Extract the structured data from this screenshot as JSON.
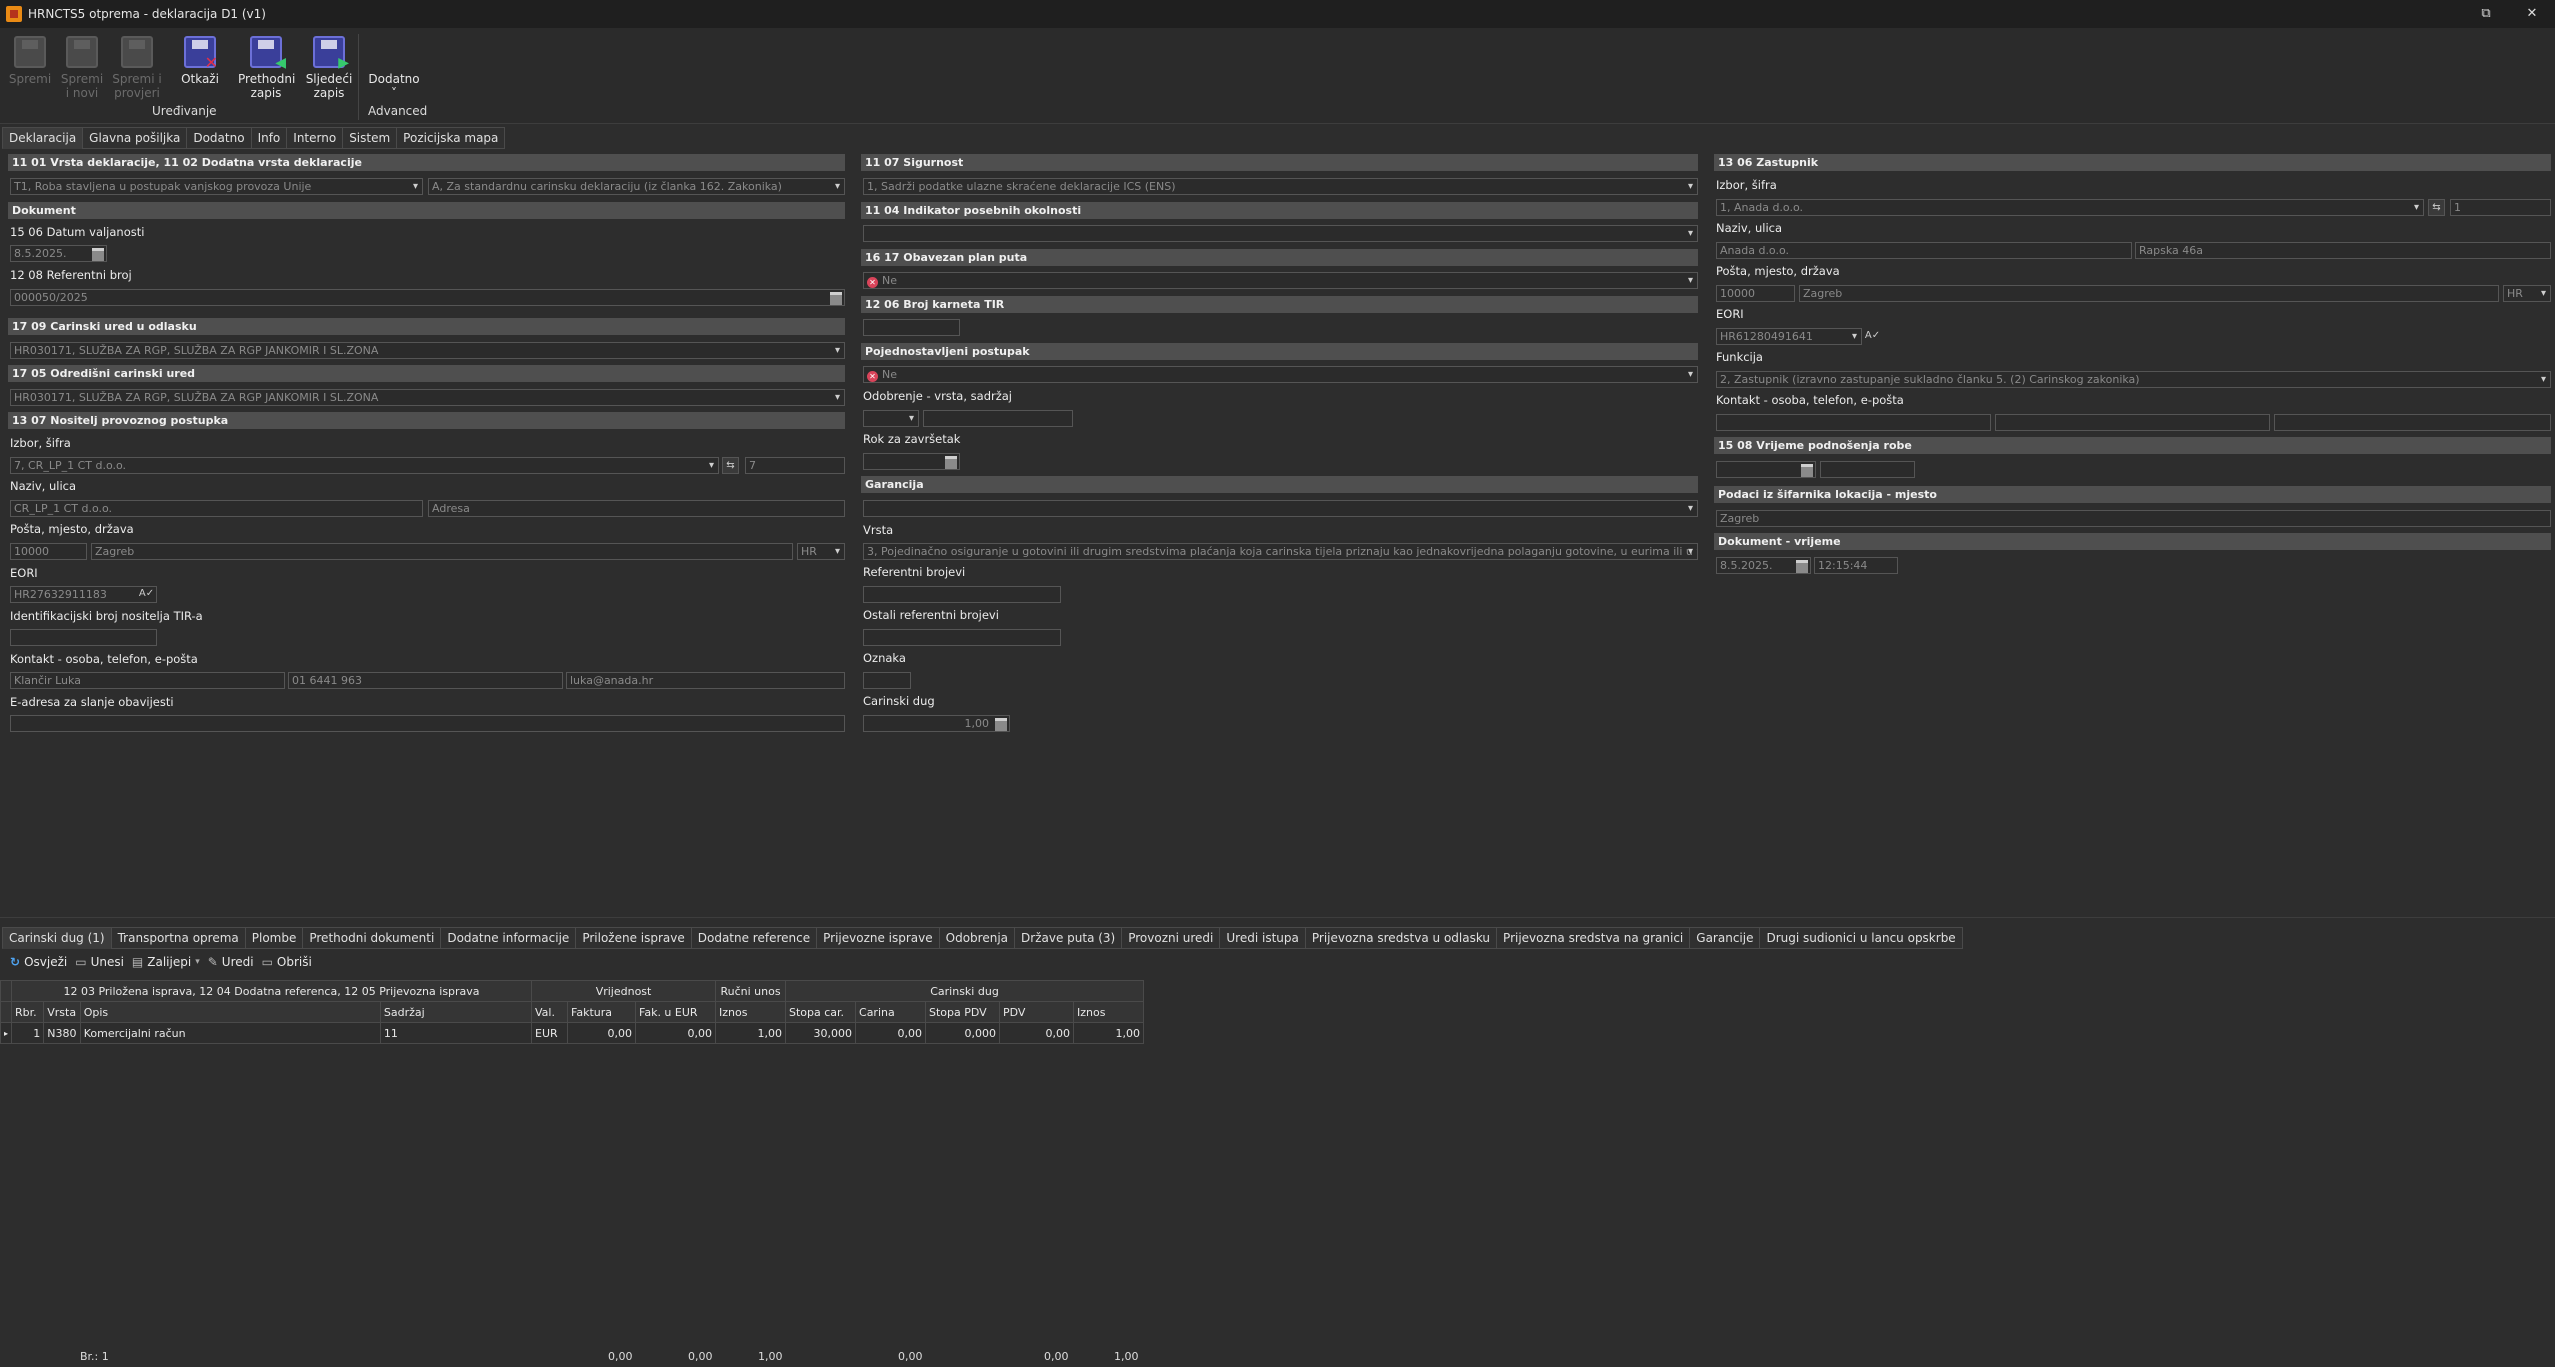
{
  "window": {
    "title": "HRNCTS5 otprema - deklaracija D1 (v1)",
    "restore": "⧉",
    "close": "✕"
  },
  "ribbon": {
    "buttons": [
      {
        "label1": "Spremi",
        "label2": "",
        "disabled": true
      },
      {
        "label1": "Spremi",
        "label2": "i novi",
        "disabled": true
      },
      {
        "label1": "Spremi i",
        "label2": "provjeri",
        "disabled": true
      },
      {
        "label1": "Otkaži",
        "label2": "",
        "disabled": false
      },
      {
        "label1": "Prethodni",
        "label2": "zapis",
        "disabled": false
      },
      {
        "label1": "Sljedeći",
        "label2": "zapis",
        "disabled": false
      },
      {
        "label1": "Dodatno",
        "label2": "˅",
        "disabled": false
      }
    ],
    "groups": {
      "edit": "Uređivanje",
      "advanced": "Advanced"
    }
  },
  "tabs": [
    "Deklaracija",
    "Glavna pošiljka",
    "Dodatno",
    "Info",
    "Interno",
    "Sistem",
    "Pozicijska mapa"
  ],
  "col1": {
    "h_vrsta": "11 01 Vrsta deklaracije, 11 02 Dodatna vrsta deklaracije",
    "vrsta1": "T1, Roba stavljena u postupak vanjskog provoza Unije",
    "vrsta2": "A, Za standardnu carinsku deklaraciju (iz članka 162. Zakonika)",
    "h_dokument": "Dokument",
    "l_datum": "15 06 Datum valjanosti",
    "datum": "8.5.2025.",
    "l_ref": "12 08 Referentni broj",
    "ref": "000050/2025",
    "h_ured_odl": "17 09 Carinski ured u odlasku",
    "ured_odl": "HR030171, SLUŽBA ZA RGP, SLUŽBA ZA RGP JANKOMIR I SL.ZONA",
    "h_ured_odr": "17 05 Odredišni carinski ured",
    "ured_odr": "HR030171, SLUŽBA ZA RGP, SLUŽBA ZA RGP JANKOMIR I SL.ZONA",
    "h_nositelj": "13 07 Nositelj provoznog postupka",
    "l_izbor": "Izbor, šifra",
    "izbor": "7, CR_LP_1 CT d.o.o.",
    "sifra": "7",
    "l_naziv": "Naziv, ulica",
    "naziv": "CR_LP_1 CT d.o.o.",
    "adresa": "Adresa",
    "l_posta": "Pošta, mjesto, država",
    "posta": "10000",
    "mjesto": "Zagreb",
    "drzava": "HR",
    "l_eori": "EORI",
    "eori": "HR27632911183",
    "l_tir": "Identifikacijski broj nositelja TIR-a",
    "l_kontakt": "Kontakt - osoba, telefon, e-pošta",
    "osoba": "Klančir Luka",
    "telefon": "01 6441 963",
    "email": "luka@anada.hr",
    "l_eadresa": "E-adresa za slanje obavijesti"
  },
  "col2": {
    "h_sigurnost": "11 07 Sigurnost",
    "sigurnost": "1, Sadrži podatke ulazne skraćene deklaracije ICS (ENS)",
    "h_indikator": "11 04 Indikator posebnih okolnosti",
    "h_plan": "16 17 Obavezan plan puta",
    "plan": "Ne",
    "h_tir": "12 06 Broj karneta TIR",
    "h_pojed": "Pojednostavljeni postupak",
    "pojed": "Ne",
    "l_odobrenje": "Odobrenje - vrsta, sadržaj",
    "l_rok": "Rok za završetak",
    "h_garancija": "Garancija",
    "l_vrsta": "Vrsta",
    "vrsta": "3, Pojedinačno osiguranje u gotovini ili drugim sredstvima plaćanja koja carinska tijela priznaju kao jednakovrijedna polaganju gotovine, u eurima ili u valut",
    "l_refbr": "Referentni brojevi",
    "l_ostali": "Ostali referentni brojevi",
    "l_oznaka": "Oznaka",
    "l_dug": "Carinski dug",
    "dug": "1,00"
  },
  "col3": {
    "h_zastupnik": "13 06 Zastupnik",
    "l_izbor": "Izbor, šifra",
    "izbor": "1, Anada d.o.o.",
    "sifra": "1",
    "l_naziv": "Naziv, ulica",
    "naziv": "Anada d.o.o.",
    "ulica": "Rapska 46a",
    "l_posta": "Pošta, mjesto, država",
    "posta": "10000",
    "mjesto": "Zagreb",
    "drzava": "HR",
    "l_eori": "EORI",
    "eori": "HR61280491641",
    "l_funkcija": "Funkcija",
    "funkcija": "2, Zastupnik (izravno zastupanje sukladno članku 5. (2) Carinskog zakonika)",
    "l_kontakt": "Kontakt - osoba, telefon, e-pošta",
    "h_vrijeme": "15 08 Vrijeme podnošenja robe",
    "h_lokacija": "Podaci iz šifarnika lokacija - mjesto",
    "lokacija": "Zagreb",
    "h_dokvr": "Dokument - vrijeme",
    "dok_datum": "8.5.2025.",
    "dok_vrijeme": "12:15:44"
  },
  "bottom_tabs": [
    "Carinski dug (1)",
    "Transportna oprema",
    "Plombe",
    "Prethodni dokumenti",
    "Dodatne informacije",
    "Priložene isprave",
    "Dodatne reference",
    "Prijevozne isprave",
    "Odobrenja",
    "Države puta (3)",
    "Provozni uredi",
    "Uredi istupa",
    "Prijevozna sredstva u odlasku",
    "Prijevozna sredstva na granici",
    "Garancije",
    "Drugi sudionici u lancu opskrbe"
  ],
  "toolbar2": {
    "osvjezi": "Osvježi",
    "unesi": "Unesi",
    "zalijepi": "Zalijepi",
    "uredi": "Uredi",
    "obrisi": "Obriši"
  },
  "grid": {
    "group_headers": {
      "docs": "12 03 Priložena isprava, 12 04 Dodatna referenca, 12 05 Prijevozna isprava",
      "vrijednost": "Vrijednost",
      "rucni": "Ručni unos",
      "dug": "Carinski dug"
    },
    "columns": [
      "Rbr.",
      "Vrsta",
      "Opis",
      "Sadržaj",
      "Val.",
      "Faktura",
      "Fak. u EUR",
      "Iznos",
      "Stopa car.",
      "Carina",
      "Stopa PDV",
      "PDV",
      "Iznos"
    ],
    "rows": [
      [
        "1",
        "N380",
        "Komercijalni račun",
        "11",
        "EUR",
        "0,00",
        "0,00",
        "1,00",
        "30,000",
        "0,00",
        "0,000",
        "0,00",
        "1,00"
      ]
    ]
  },
  "footer": {
    "count": "Br.: 1",
    "faktura": "0,00",
    "fakeur": "0,00",
    "iznos": "1,00",
    "carina": "0,00",
    "pdv": "0,00",
    "iznos2": "1,00"
  }
}
